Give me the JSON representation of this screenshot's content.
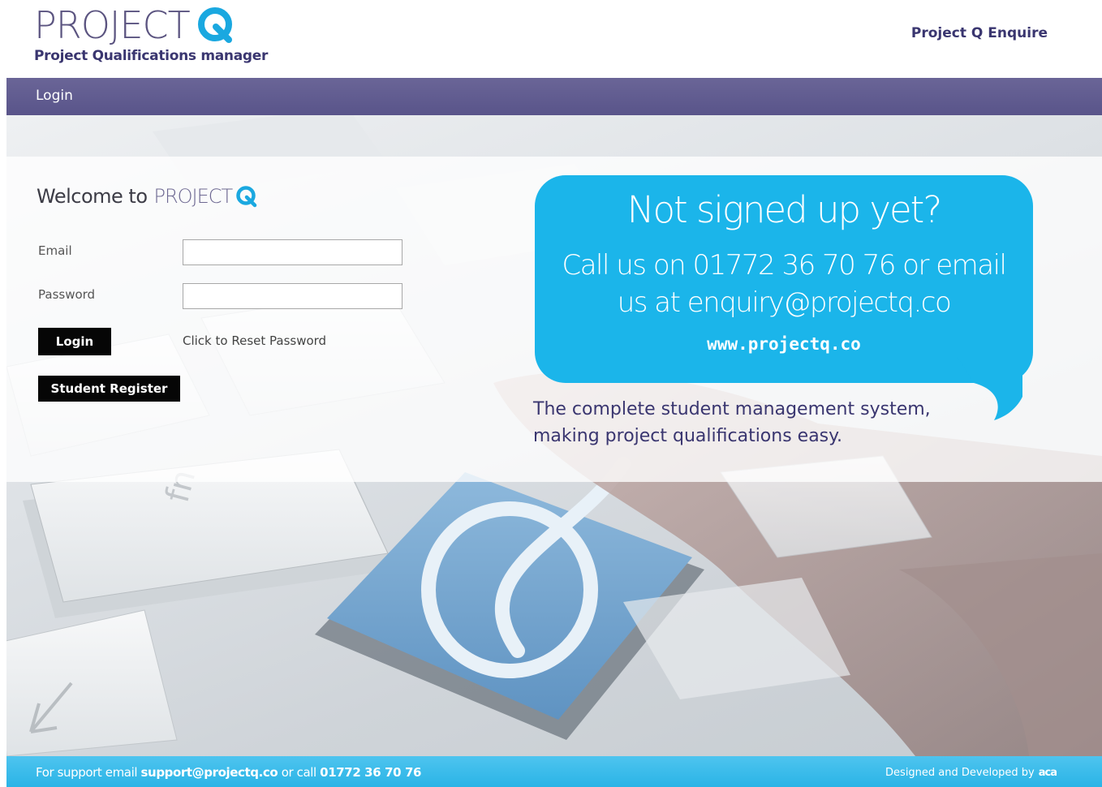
{
  "header": {
    "logo_word": "PROJECT",
    "logo_tagline": "Project Qualifications manager",
    "enquire_link": "Project Q Enquire"
  },
  "nav": {
    "login": "Login"
  },
  "form": {
    "welcome_prefix": "Welcome to",
    "welcome_brand": "PROJECT",
    "email_label": "Email",
    "email_value": "",
    "password_label": "Password",
    "password_value": "",
    "login_button": "Login",
    "reset_link": "Click to Reset Password",
    "register_button": "Student Register"
  },
  "promo": {
    "title": "Not signed up yet?",
    "line1": "Call us on 01772 36 70 76 or email",
    "line2": "us at enquiry@projectq.co",
    "url": "www.projectq.co",
    "tagline_line1": "The complete student management system,",
    "tagline_line2": "making project qualifications easy."
  },
  "footer": {
    "support_prefix": "For support email",
    "support_email": "support@projectq.co",
    "support_mid": "or call",
    "support_phone": "01772 36 70 76",
    "credit": "Designed and Developed by",
    "credit_logo": "aca"
  },
  "colors": {
    "brand_purple": "#59548a",
    "brand_blue": "#1bb5ea",
    "footer_blue": "#2ab4e6",
    "button_black": "#060606"
  },
  "icons": {
    "logo_q": "q-logo-icon",
    "keyboard_q_key": "q-key-icon",
    "keyboard_arrow": "arrow-key-icon"
  }
}
